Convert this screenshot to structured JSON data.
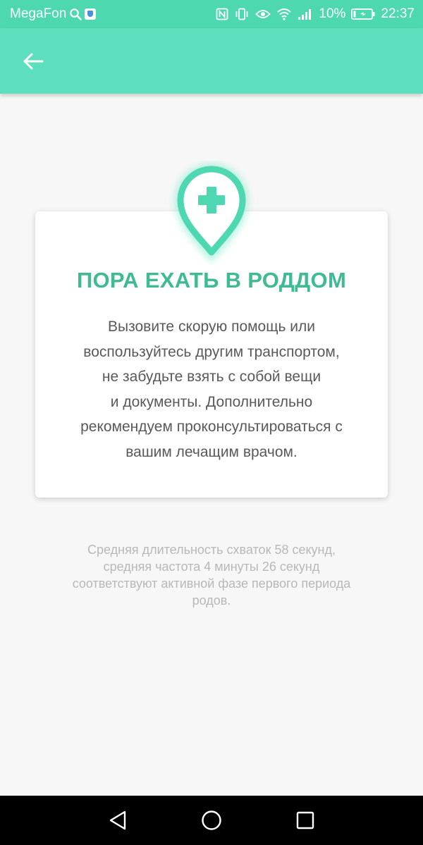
{
  "status_bar": {
    "carrier": "MegaFon",
    "battery_percent": "10%",
    "time": "22:37",
    "icons": [
      "search-icon",
      "shield-icon",
      "nfc-icon",
      "vibrate-icon",
      "eye-icon",
      "wifi-icon",
      "signal-icon",
      "battery-charging-icon"
    ]
  },
  "toolbar": {
    "back_icon": "arrow-left-icon"
  },
  "alert": {
    "icon": "medical-location-pin-icon",
    "title": "ПОРА ЕХАТЬ В РОДДОМ",
    "lines": [
      "Вызовите скорую помощь или",
      "воспользуйтесь другим транспортом,",
      "не забудьте взять с собой вещи",
      "и документы. Дополнительно",
      "рекомендуем проконсультироваться с",
      "вашим лечащим врачом."
    ]
  },
  "footnote": {
    "lines": [
      "Средняя длительность схваток 58 секунд,",
      "средняя частота 4 минуты 26 секунд",
      "соответствуют активной фазе первого периода",
      "родов."
    ]
  },
  "nav_bar": {
    "icons": [
      "back-triangle-icon",
      "home-circle-icon",
      "recents-square-icon"
    ]
  },
  "colors": {
    "status_bar": "#4dd8b0",
    "toolbar": "#5ddfbd",
    "accent": "#3fba94",
    "pin": "#4ed8b2",
    "background": "#f7f7f7"
  }
}
